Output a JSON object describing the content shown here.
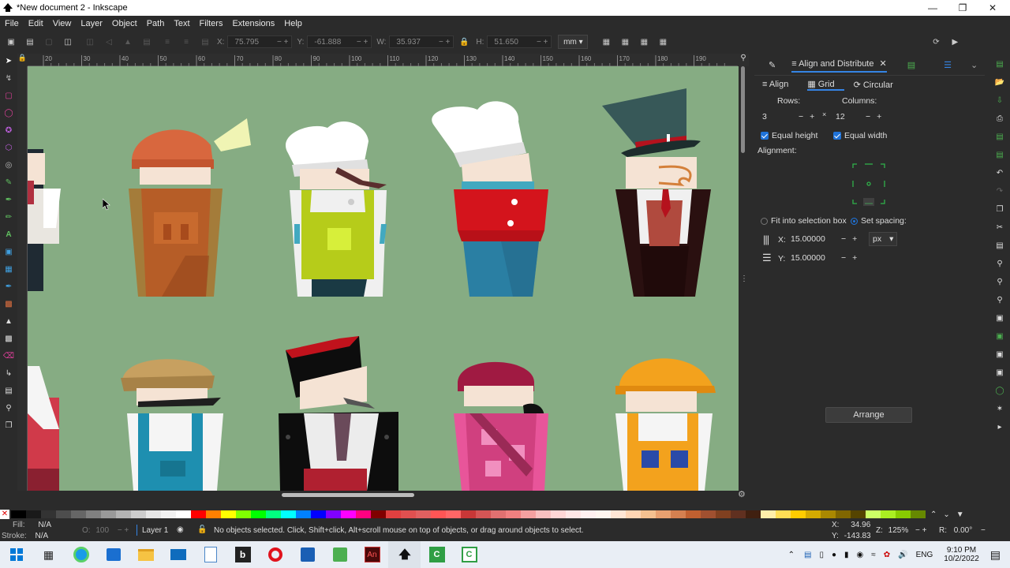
{
  "window": {
    "title": "*New document 2 - Inkscape"
  },
  "menu": [
    "File",
    "Edit",
    "View",
    "Layer",
    "Object",
    "Path",
    "Text",
    "Filters",
    "Extensions",
    "Help"
  ],
  "toolbar": {
    "x_label": "X:",
    "x_value": "75.795",
    "y_label": "Y:",
    "y_value": "-61.888",
    "w_label": "W:",
    "w_value": "35.937",
    "h_label": "H:",
    "h_value": "51.650",
    "unit": "mm"
  },
  "ruler_ticks": [
    "20",
    "30",
    "40",
    "50",
    "60",
    "70",
    "80",
    "90",
    "100",
    "110",
    "120",
    "130",
    "140",
    "150",
    "160",
    "170",
    "180",
    "190"
  ],
  "panel": {
    "tab_title": "Align and Distribute",
    "subtabs": [
      "Align",
      "Grid",
      "Circular"
    ],
    "rows_label": "Rows:",
    "columns_label": "Columns:",
    "rows_value": "3",
    "columns_value": "12",
    "equal_height": "Equal height",
    "equal_width": "Equal width",
    "alignment_label": "Alignment:",
    "fit_label": "Fit into selection box",
    "spacing_label": "Set spacing:",
    "x_spacing_label": "X:",
    "x_spacing": "15.00000",
    "y_spacing_label": "Y:",
    "y_spacing": "15.00000",
    "spacing_unit": "px",
    "arrange_button": "Arrange"
  },
  "status": {
    "fill_label": "Fill:",
    "fill_value": "N/A",
    "stroke_label": "Stroke:",
    "stroke_value": "N/A",
    "opacity_label": "O:",
    "opacity_value": "100",
    "layer": "Layer 1",
    "message": "No objects selected. Click, Shift+click, Alt+scroll mouse on top of objects, or drag around objects to select.",
    "x_label": "X:",
    "x_value": "34.96",
    "y_label": "Y:",
    "y_value": "-143.83",
    "zoom_label": "Z:",
    "zoom_value": "125%",
    "rotate_label": "R:",
    "rotate_value": "0.00°"
  },
  "taskbar": {
    "lang": "ENG",
    "time": "9:10 PM",
    "date": "10/2/2022"
  },
  "palette_colors": [
    "#000000",
    "#1a1a1a",
    "#333333",
    "#4d4d4d",
    "#666666",
    "#808080",
    "#999999",
    "#b3b3b3",
    "#cccccc",
    "#e6e6e6",
    "#f2f2f2",
    "#ffffff",
    "#ff0000",
    "#ff8000",
    "#ffff00",
    "#80ff00",
    "#00ff00",
    "#00ff80",
    "#00ffff",
    "#0080ff",
    "#0000ff",
    "#8000ff",
    "#ff00ff",
    "#ff0080",
    "#800000",
    "#e04040",
    "#e05050",
    "#e06060",
    "#ff5555",
    "#ff6666",
    "#c83737",
    "#d45555",
    "#e07070",
    "#f08080",
    "#f4a0a0",
    "#f8c0c0",
    "#ffd5d5",
    "#ffe6e6",
    "#fff0f0",
    "#fff6f0",
    "#ffe6d5",
    "#ffd5b4",
    "#f4c090",
    "#e8a070",
    "#d48050",
    "#c06030",
    "#a05030",
    "#804020",
    "#603020",
    "#402010",
    "#ffeeaa",
    "#ffdd55",
    "#ffcc00",
    "#d4aa00",
    "#aa8800",
    "#806600",
    "#554400",
    "#ccff66",
    "#aaee22",
    "#88cc00",
    "#668800"
  ]
}
